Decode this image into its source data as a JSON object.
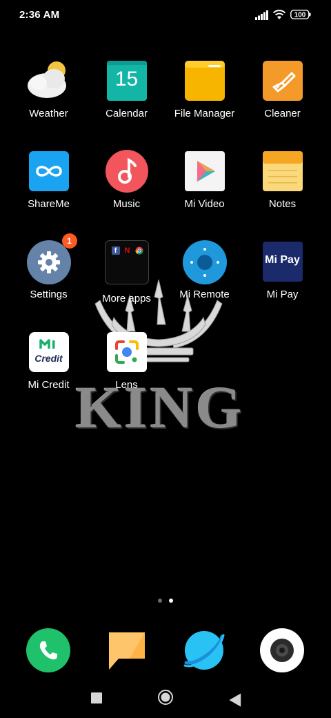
{
  "status_bar": {
    "time": "2:36 AM",
    "battery": "100",
    "icons": [
      "signal-icon",
      "wifi-icon",
      "battery-icon"
    ]
  },
  "wallpaper": {
    "text": "KING"
  },
  "apps": [
    {
      "label": "Weather",
      "icon": "weather-icon"
    },
    {
      "label": "Calendar",
      "icon": "calendar-icon",
      "date": "15"
    },
    {
      "label": "File Manager",
      "icon": "folder-icon"
    },
    {
      "label": "Cleaner",
      "icon": "broom-icon"
    },
    {
      "label": "ShareMe",
      "icon": "infinity-icon"
    },
    {
      "label": "Music",
      "icon": "music-note-icon"
    },
    {
      "label": "Mi Video",
      "icon": "play-icon"
    },
    {
      "label": "Notes",
      "icon": "notepad-icon"
    },
    {
      "label": "Settings",
      "icon": "gear-icon",
      "badge": "1"
    },
    {
      "label": "More apps",
      "icon": "folder-grid-icon",
      "folder_items": [
        "f",
        "N"
      ]
    },
    {
      "label": "Mi Remote",
      "icon": "remote-icon"
    },
    {
      "label": "Mi Pay",
      "icon": "mipay-icon",
      "icon_text": "Mi Pay"
    },
    {
      "label": "Mi Credit",
      "icon": "mi-credit-icon",
      "icon_text": "Credit"
    },
    {
      "label": "Lens",
      "icon": "lens-icon"
    }
  ],
  "page_indicator": {
    "pages": 2,
    "current": 2
  },
  "dock": [
    "phone-icon",
    "messages-icon",
    "browser-icon",
    "camera-icon"
  ],
  "nav_bar": [
    "recents-icon",
    "home-icon",
    "back-icon"
  ],
  "colors": {
    "background": "#000000",
    "badge": "#ff5a1f",
    "phone": "#1fc16b",
    "browser": "#29c2f5"
  }
}
